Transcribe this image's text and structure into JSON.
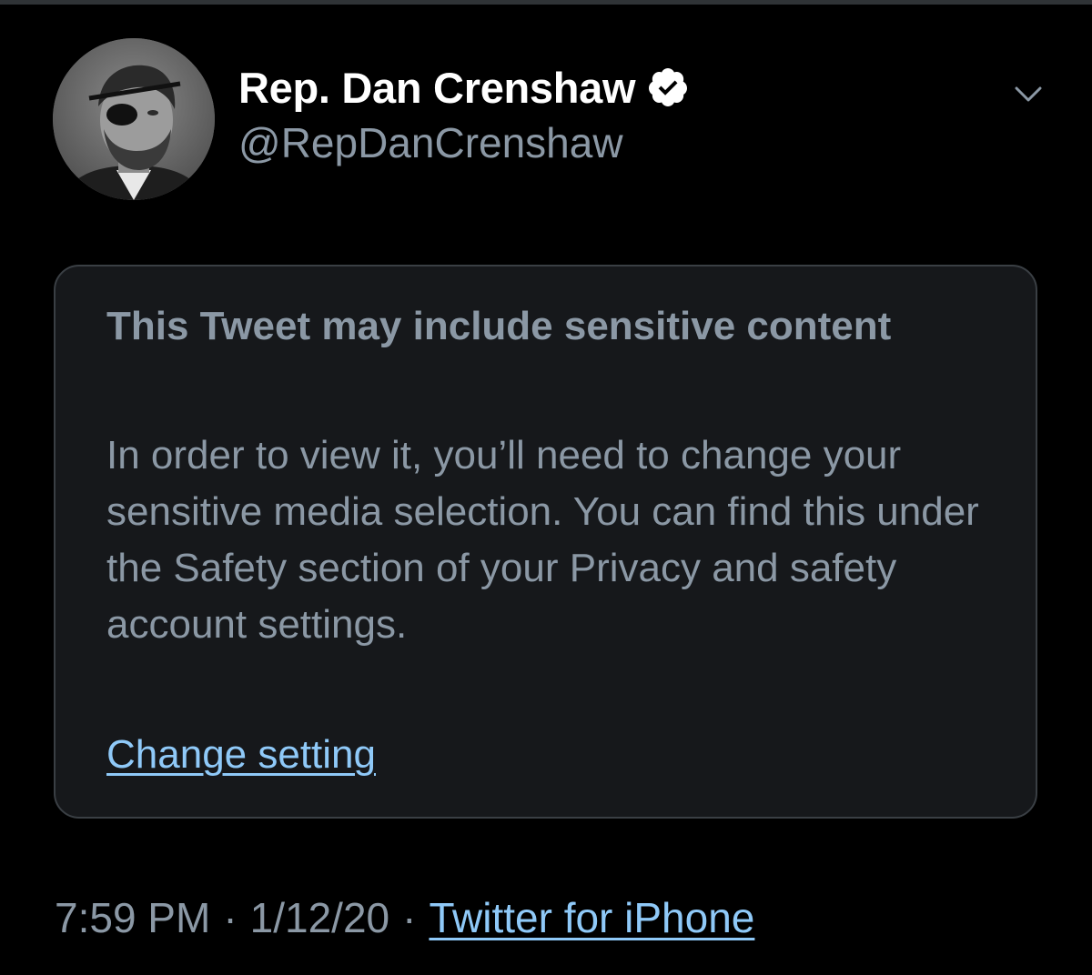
{
  "tweet": {
    "author": {
      "display_name": "Rep. Dan Crenshaw",
      "handle": "@RepDanCrenshaw",
      "verified": true,
      "avatar": "profile-photo"
    },
    "menu_icon": "chevron-down-icon",
    "sensitive_notice": {
      "title": "This Tweet may include sensitive content",
      "body": "In order to view it, you’ll need to change your sensitive media selection. You can find this under the Safety section of your Privacy and safety account settings.",
      "link_label": "Change setting"
    },
    "meta": {
      "time": "7:59 PM",
      "separator": "·",
      "date": "1/12/20",
      "source": "Twitter for iPhone"
    }
  },
  "colors": {
    "background": "#000000",
    "secondary_text": "#8b98a5",
    "link": "#8fc9f8",
    "card_background": "#16181b",
    "card_border": "#3a3f44"
  }
}
